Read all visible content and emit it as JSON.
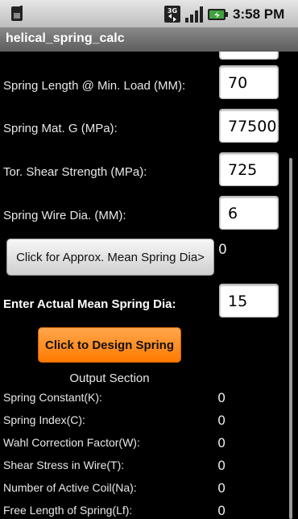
{
  "status": {
    "time": "3:58 PM",
    "network_badge": "3G",
    "icons": [
      "sim-card-icon",
      "3g-icon",
      "signal-strength-icon",
      "battery-charging-icon"
    ]
  },
  "app": {
    "title": "helical_spring_calc"
  },
  "inputs": [
    {
      "label": "Spring Length @ Min. Load (MM):",
      "value": "70"
    },
    {
      "label": "Spring Mat. G (MPa):",
      "value": "77500"
    },
    {
      "label": "Tor. Shear Strength (MPa):",
      "value": "725"
    },
    {
      "label": "Spring Wire Dia. (MM):",
      "value": "6"
    }
  ],
  "approx_button": {
    "label": "Click for Approx. Mean Spring Dia>",
    "result": "0"
  },
  "mean_dia": {
    "label": "Enter Actual Mean Spring Dia:",
    "value": "15"
  },
  "design_button": {
    "label": "Click to Design Spring"
  },
  "output": {
    "title": "Output Section",
    "rows": [
      {
        "label": "Spring Constant(K):",
        "value": "0"
      },
      {
        "label": "Spring Index(C):",
        "value": "0"
      },
      {
        "label": "Wahl Correction Factor(W):",
        "value": "0"
      },
      {
        "label": "Shear Stress in Wire(T):",
        "value": "0"
      },
      {
        "label": "Number of Active Coil(Na):",
        "value": "0"
      },
      {
        "label": "Free Length of Spring(Lf):",
        "value": "0"
      }
    ]
  },
  "colors": {
    "accent_orange": "#ff8c1a",
    "background": "#000000",
    "titlebar": "#6f6f6f"
  }
}
